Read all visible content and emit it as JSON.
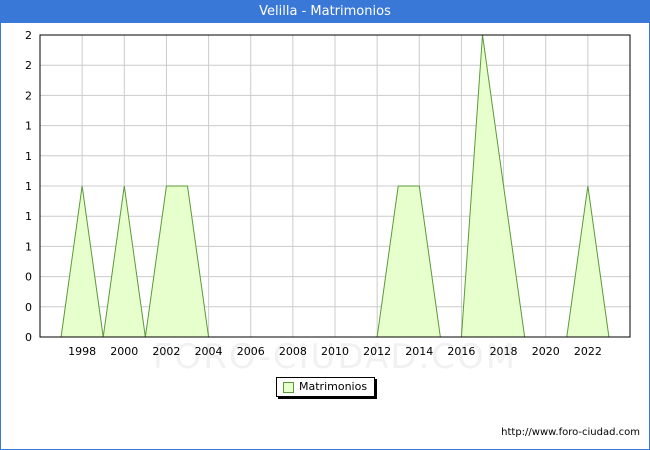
{
  "title": "Velilla - Matrimonios",
  "source": "http://www.foro-ciudad.com",
  "watermark": "FORO-CIUDAD.COM",
  "legend": {
    "label": "Matrimonios"
  },
  "colors": {
    "titlebar": "#3a78d8",
    "fill": "#e6ffcc",
    "stroke": "#5a9a3a",
    "grid": "#cccccc"
  },
  "chart_data": {
    "type": "area",
    "series": [
      {
        "name": "Matrimonios",
        "x": [
          1997,
          1998,
          1999,
          2000,
          2001,
          2002,
          2003,
          2004,
          2005,
          2006,
          2007,
          2008,
          2009,
          2010,
          2011,
          2012,
          2013,
          2014,
          2015,
          2016,
          2017,
          2018,
          2019,
          2020,
          2021,
          2022,
          2023
        ],
        "values": [
          0,
          1,
          0,
          1,
          0,
          1,
          1,
          0,
          0,
          0,
          0,
          0,
          0,
          0,
          0,
          0,
          1,
          1,
          0,
          0,
          2,
          1,
          0,
          0,
          0,
          1,
          0
        ]
      }
    ],
    "xlim": [
      1996,
      2024
    ],
    "ylim": [
      0,
      2
    ],
    "x_ticks": [
      1998,
      2000,
      2002,
      2004,
      2006,
      2008,
      2010,
      2012,
      2014,
      2016,
      2018,
      2020,
      2022
    ],
    "y_ticks": [
      {
        "value": 0,
        "label": "0"
      },
      {
        "value": 0.2,
        "label": "0"
      },
      {
        "value": 0.4,
        "label": "0"
      },
      {
        "value": 0.6,
        "label": "1"
      },
      {
        "value": 0.8,
        "label": "1"
      },
      {
        "value": 1.0,
        "label": "1"
      },
      {
        "value": 1.2,
        "label": "1"
      },
      {
        "value": 1.4,
        "label": "1"
      },
      {
        "value": 1.6,
        "label": "2"
      },
      {
        "value": 1.8,
        "label": "2"
      },
      {
        "value": 2.0,
        "label": "2"
      }
    ],
    "grid": true,
    "legend_position": "bottom"
  }
}
